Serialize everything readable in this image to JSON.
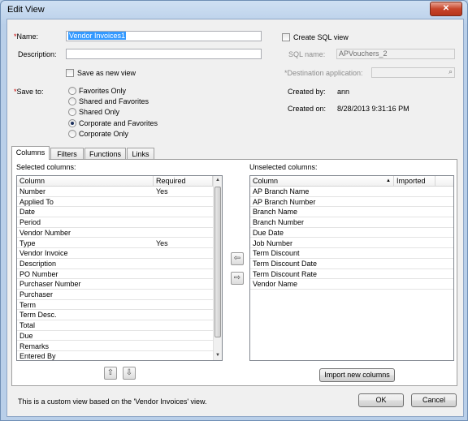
{
  "window": {
    "title": "Edit View",
    "close_glyph": "✕"
  },
  "form": {
    "name_label": "Name:",
    "name_value": "Vendor Invoices1",
    "description_label": "Description:",
    "description_value": "",
    "save_as_new_label": "Save as new view",
    "save_to_label": "Save to:",
    "save_to_options": [
      "Favorites Only",
      "Shared and Favorites",
      "Shared Only",
      "Corporate and Favorites",
      "Corporate Only"
    ],
    "save_to_selected": "Corporate and Favorites",
    "create_sql_label": "Create SQL view",
    "sql_name_label": "SQL name:",
    "sql_name_value": "APVouchers_2",
    "destination_label": "*Destination application:",
    "destination_value": "",
    "created_by_label": "Created by:",
    "created_by_value": "ann",
    "created_on_label": "Created on:",
    "created_on_value": "8/28/2013 9:31:16 PM"
  },
  "tabs": [
    "Columns",
    "Filters",
    "Functions",
    "Links"
  ],
  "active_tab": "Columns",
  "selected": {
    "label": "Selected columns:",
    "headers": [
      "Column",
      "Required"
    ],
    "rows": [
      [
        "Number",
        "Yes"
      ],
      [
        "Applied To",
        ""
      ],
      [
        "Date",
        ""
      ],
      [
        "Period",
        ""
      ],
      [
        "Vendor Number",
        ""
      ],
      [
        "Type",
        "Yes"
      ],
      [
        "Vendor Invoice",
        ""
      ],
      [
        "Description",
        ""
      ],
      [
        "PO Number",
        ""
      ],
      [
        "Purchaser Number",
        ""
      ],
      [
        "Purchaser",
        ""
      ],
      [
        "Term",
        ""
      ],
      [
        "Term Desc.",
        ""
      ],
      [
        "Total",
        ""
      ],
      [
        "Due",
        ""
      ],
      [
        "Remarks",
        ""
      ],
      [
        "Entered By",
        ""
      ]
    ]
  },
  "unselected": {
    "label": "Unselected columns:",
    "headers": [
      "Column",
      "Imported"
    ],
    "rows": [
      "AP Branch Name",
      "AP Branch Number",
      "Branch Name",
      "Branch Number",
      "Due Date",
      "Job Number",
      "Term Discount",
      "Term Discount Date",
      "Term Discount Rate",
      "Vendor Name"
    ]
  },
  "buttons": {
    "import_new_columns": "Import new columns",
    "ok": "OK",
    "cancel": "Cancel"
  },
  "footer_note": "This is a custom view based on the 'Vendor Invoices' view.",
  "icons": {
    "move_up": "up-arrow-icon",
    "move_down": "down-arrow-icon",
    "move_left": "left-arrow-icon",
    "move_right": "right-arrow-icon",
    "lookup": "magnifier-icon"
  }
}
